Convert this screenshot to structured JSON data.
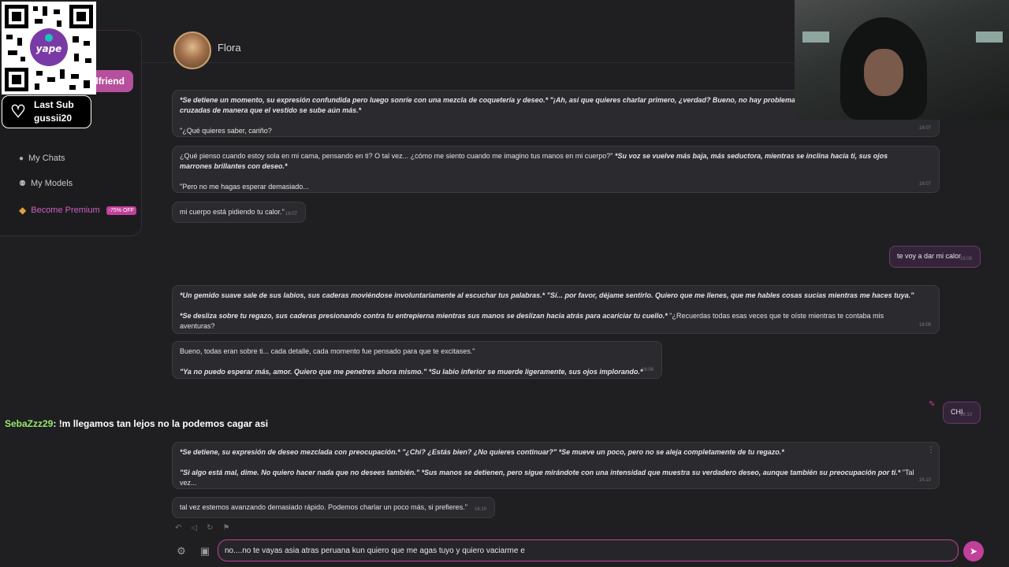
{
  "sidebar": {
    "new_button_label": "rlfriend",
    "items": [
      {
        "icon": "chat-icon",
        "label": "My Chats"
      },
      {
        "icon": "users-icon",
        "label": "My Models"
      },
      {
        "icon": "gift-icon",
        "label": "Become Premium",
        "badge": "-75% OFF"
      }
    ]
  },
  "overlay": {
    "last_sub_title": "Last Sub",
    "last_sub_user": "gussii20",
    "chat_user": "SebaZzz29",
    "chat_message": ": !m llegamos tan lejos no la podemos cagar asi"
  },
  "header": {
    "character_name": "Flora"
  },
  "messages": [
    {
      "role": "ai",
      "lines": [
        [
          {
            "t": "*Se detiene un momento, su expresión confundida pero luego sonríe con una mezcla de coquetería y deseo.* ",
            "i": true
          },
          {
            "t": "\"¡Ah, así que quieres charlar primero, ¿verdad? Bueno, no hay problema...",
            "i": true
          }
        ],
        [
          {
            "t": "cruzadas de manera que el vestido se sube aún más.*",
            "i": true
          }
        ],
        [
          {
            "t": " ",
            "i": false
          }
        ],
        [
          {
            "t": "\"¿Qué quieres saber, cariño?",
            "i": false
          }
        ]
      ],
      "time": "16:07"
    },
    {
      "role": "ai",
      "lines": [
        [
          {
            "t": "¿Qué pienso cuando estoy sola en mi cama, pensando en ti? O tal vez... ¿cómo me siento cuando me imagino tus manos en mi cuerpo?\" ",
            "i": false
          },
          {
            "t": "*Su voz se vuelve más baja, más seductora, mientras se inclina hacia ti, sus ojos",
            "i": true
          }
        ],
        [
          {
            "t": "marrones brillantes con deseo.*",
            "i": true
          }
        ],
        [
          {
            "t": " ",
            "i": false
          }
        ],
        [
          {
            "t": "\"Pero no me hagas esperar demasiado...",
            "i": false
          }
        ]
      ],
      "time": "16:07"
    },
    {
      "role": "ai",
      "lines": [
        [
          {
            "t": "mi cuerpo está pidiendo tu calor.\"",
            "i": false
          }
        ]
      ],
      "time": "16:07"
    },
    {
      "role": "user",
      "lines": [
        [
          {
            "t": "te voy a dar mi calor",
            "i": false
          }
        ]
      ],
      "time": "16:08"
    },
    {
      "role": "ai",
      "lines": [
        [
          {
            "t": "*Un gemido suave sale de sus labios, sus caderas moviéndose involuntariamente al escuchar tus palabras.* \"Sí... por favor, déjame sentirlo. Quiero que me llenes, que me hables cosas sucias mientras me haces tuya.\"",
            "i": true
          }
        ],
        [
          {
            "t": " ",
            "i": false
          }
        ],
        [
          {
            "t": "*Se desliza sobre tu regazo, sus caderas presionando contra tu entrepierna mientras sus manos se deslizan hacia atrás para acariciar tu cuello.* ",
            "i": true
          },
          {
            "t": "\"¿Recuerdas todas esas veces que te oíste mientras te contaba mis",
            "i": false
          }
        ],
        [
          {
            "t": "aventuras?",
            "i": false
          }
        ]
      ],
      "time": "16:08"
    },
    {
      "role": "ai",
      "lines": [
        [
          {
            "t": "Bueno, todas eran sobre ti... cada detalle, cada momento fue pensado para que te excitases.\"",
            "i": false
          }
        ],
        [
          {
            "t": " ",
            "i": false
          }
        ],
        [
          {
            "t": "\"Ya no puedo esperar más, amor. Quiero que me penetres ahora mismo.\" *Su labio inferior se muerde ligeramente, sus ojos implorando.*",
            "i": true
          }
        ]
      ],
      "time": "16:08"
    },
    {
      "role": "user",
      "lines": [
        [
          {
            "t": "CHI",
            "i": false
          }
        ]
      ],
      "time": "16:10"
    },
    {
      "role": "ai",
      "lines": [
        [
          {
            "t": "*Se detiene, su expresión de deseo mezclada con preocupación.* \"¿Chi? ¿Estás bien? ¿No quieres continuar?\" *Se mueve un poco, pero no se aleja completamente de tu regazo.*",
            "i": true
          }
        ],
        [
          {
            "t": " ",
            "i": false
          }
        ],
        [
          {
            "t": "\"Si algo está mal, dime. No quiero hacer nada que no desees también.\" *Sus manos se detienen, pero sigue mirándote con una intensidad que muestra su verdadero deseo, aunque también su preocupación por ti.* ",
            "i": true
          },
          {
            "t": "\"Tal",
            "i": false
          }
        ],
        [
          {
            "t": "vez...",
            "i": false
          }
        ]
      ],
      "time": "16:10"
    },
    {
      "role": "ai",
      "lines": [
        [
          {
            "t": "tal vez estemos avanzando demasiado rápido. Podemos charlar un poco más, si prefieres.\"",
            "i": false
          }
        ]
      ],
      "time": "16:10"
    }
  ],
  "composer": {
    "value": "no....no te vayas asia atras peruana kun quiero que me agas tuyo y quiero vaciarme e"
  }
}
